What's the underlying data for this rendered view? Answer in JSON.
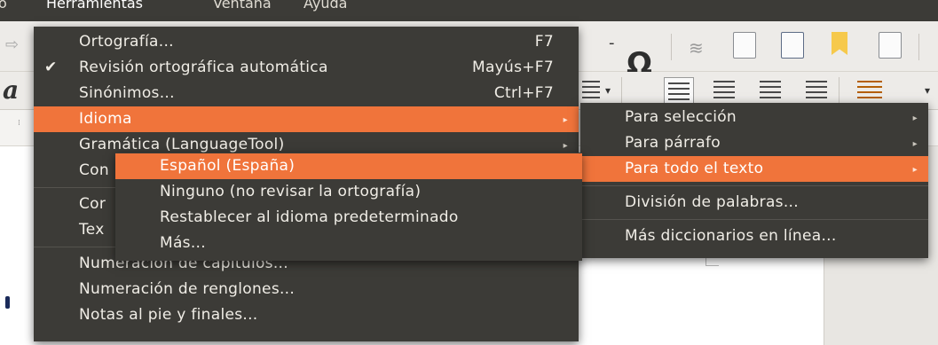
{
  "menubar": {
    "items": [
      "o",
      "Herramientas",
      "Ventana",
      "Ayuda"
    ]
  },
  "tools_menu": {
    "items": [
      {
        "label": "Ortografía...",
        "shortcut": "F7"
      },
      {
        "label": "Revisión ortográfica automática",
        "shortcut": "Mayús+F7",
        "checked": true
      },
      {
        "label": "Sinónimos...",
        "shortcut": "Ctrl+F7"
      },
      {
        "label": "Idioma",
        "submenu": true,
        "highlighted": true
      },
      {
        "label": "Gramática (LanguageTool)",
        "submenu": true
      },
      {
        "label": "Con"
      },
      {
        "label": "Cor"
      },
      {
        "label": "Tex"
      },
      {
        "label": "Numeración de capítulos..."
      },
      {
        "label": "Numeración de renglones..."
      },
      {
        "label": "Notas al pie y finales..."
      }
    ]
  },
  "language_menu": {
    "items": [
      {
        "label": "Para selección",
        "submenu": true
      },
      {
        "label": "Para párrafo",
        "submenu": true
      },
      {
        "label": "Para todo el texto",
        "submenu": true,
        "highlighted": true
      },
      {
        "label": "División de palabras..."
      },
      {
        "label": "Más diccionarios en línea..."
      }
    ]
  },
  "all_text_menu": {
    "items": [
      {
        "label": "Español (España)",
        "highlighted": true
      },
      {
        "label": "Ninguno (no revisar la ortografía)"
      },
      {
        "label": "Restablecer al idioma predeterminado"
      },
      {
        "label": "Más..."
      }
    ]
  },
  "toolbar": {
    "special_char_symbol": "Ω",
    "italic_glyph": "a"
  },
  "colors": {
    "menu_bg": "#3c3b37",
    "highlight": "#f0743b",
    "menu_text": "#f0ede6"
  },
  "icons": [
    "checkmark-icon",
    "submenu-arrow-icon",
    "omega-icon",
    "footnote-icon",
    "bookmark-icon",
    "align-left-icon",
    "align-center-icon",
    "align-right-icon",
    "justify-icon",
    "line-spacing-icon"
  ]
}
